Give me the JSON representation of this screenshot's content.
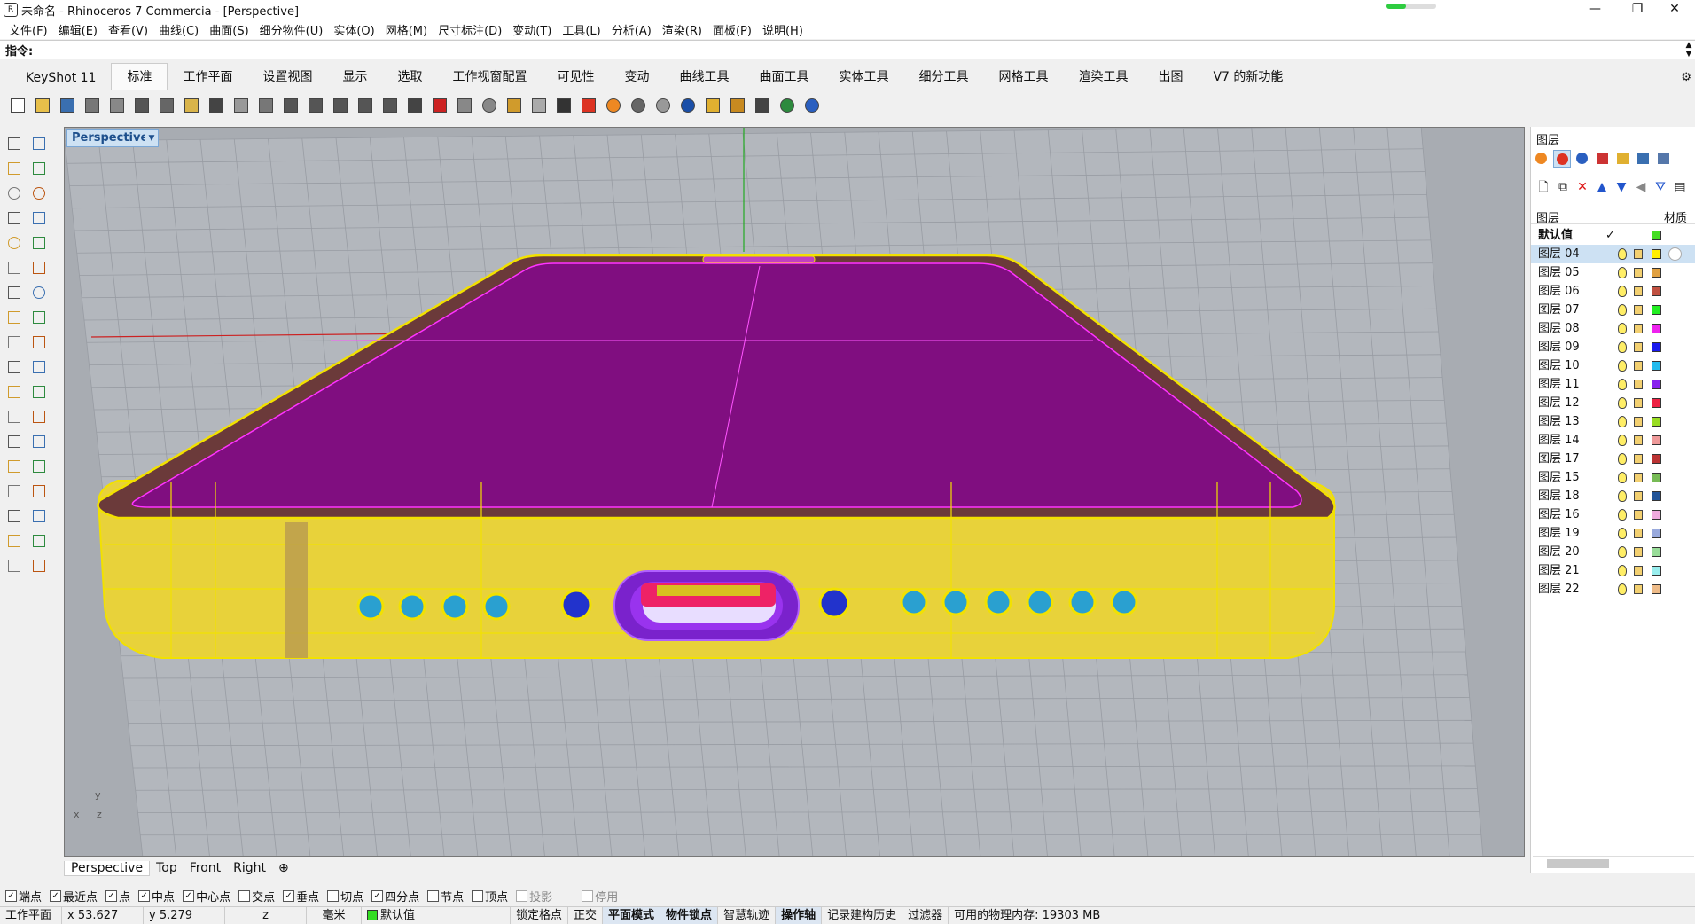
{
  "window": {
    "title": "未命名 - Rhinoceros 7 Commercia - [Perspective]",
    "app_icon": "rhino-icon",
    "progress_percent": 40,
    "controls": {
      "minimize": "—",
      "restore": "❐",
      "close": "✕"
    }
  },
  "menubar": {
    "items": [
      "文件(F)",
      "编辑(E)",
      "查看(V)",
      "曲线(C)",
      "曲面(S)",
      "细分物件(U)",
      "实体(O)",
      "网格(M)",
      "尺寸标注(D)",
      "变动(T)",
      "工具(L)",
      "分析(A)",
      "渲染(R)",
      "面板(P)",
      "说明(H)"
    ]
  },
  "command": {
    "label": "指令:",
    "value": "",
    "scroll_up": "▲",
    "scroll_down": "▼"
  },
  "tabs": {
    "items": [
      "KeyShot 11",
      "标准",
      "工作平面",
      "设置视图",
      "显示",
      "选取",
      "工作视窗配置",
      "可见性",
      "变动",
      "曲线工具",
      "曲面工具",
      "实体工具",
      "细分工具",
      "网格工具",
      "渲染工具",
      "出图",
      "V7 的新功能"
    ],
    "active_index": 1,
    "gear": "⚙"
  },
  "toolbar": {
    "icons": [
      {
        "name": "new-file-icon",
        "color": "#ffffff"
      },
      {
        "name": "open-folder-icon",
        "color": "#e8c04a"
      },
      {
        "name": "save-icon",
        "color": "#3a6fb0"
      },
      {
        "name": "print-icon",
        "color": "#777777"
      },
      {
        "name": "export-icon",
        "color": "#888888"
      },
      {
        "name": "cut-icon",
        "color": "#555555"
      },
      {
        "name": "copy-icon",
        "color": "#666666"
      },
      {
        "name": "paste-icon",
        "color": "#d9b44a"
      },
      {
        "name": "undo-icon",
        "color": "#444444"
      },
      {
        "name": "pan-hand-icon",
        "color": "#999999"
      },
      {
        "name": "move-arrows-icon",
        "color": "#777777"
      },
      {
        "name": "zoom-window-icon",
        "color": "#555555"
      },
      {
        "name": "zoom-extents-icon",
        "color": "#555555"
      },
      {
        "name": "zoom-all-icon",
        "color": "#555555"
      },
      {
        "name": "zoom-selected-icon",
        "color": "#555555"
      },
      {
        "name": "rotate-view-icon",
        "color": "#555555"
      },
      {
        "name": "four-view-icon",
        "color": "#444444"
      },
      {
        "name": "car-icon",
        "color": "#cc2222"
      },
      {
        "name": "plane-icon",
        "color": "#888888"
      },
      {
        "name": "snap-circle-icon",
        "color": "#888888"
      },
      {
        "name": "scale-icon",
        "color": "#d09b2c"
      },
      {
        "name": "bulb-icon",
        "color": "#aaaaaa"
      },
      {
        "name": "lock-icon",
        "color": "#333333"
      },
      {
        "name": "layer-icon",
        "color": "#dd3322"
      },
      {
        "name": "color-wheel-icon",
        "color": "#ee8822"
      },
      {
        "name": "shaded-sphere-icon",
        "color": "#666666"
      },
      {
        "name": "render-sphere-icon",
        "color": "#999999"
      },
      {
        "name": "blue-sphere-icon",
        "color": "#1a4fa8"
      },
      {
        "name": "pen-icon",
        "color": "#e0b030"
      },
      {
        "name": "gears-icon",
        "color": "#c88a20"
      },
      {
        "name": "grid-snap-icon",
        "color": "#444444"
      },
      {
        "name": "globe-icon",
        "color": "#2d8a3e"
      },
      {
        "name": "help-icon",
        "color": "#2a5fc0"
      }
    ]
  },
  "left_palette": {
    "icons": [
      "select-arrow-icon",
      "point-icon",
      "polyline-icon",
      "curve-icon",
      "circle-icon",
      "arc-icon",
      "polygon-icon",
      "rectangle-icon",
      "ellipse-icon",
      "freeform-icon",
      "surface-icon",
      "revolve-icon",
      "box-icon",
      "sphere-icon",
      "cylinder-icon",
      "mesh-icon",
      "boolean-icon",
      "fillet-icon",
      "trim-icon",
      "split-icon",
      "explode-icon",
      "join-icon",
      "move-icon",
      "rotate-icon",
      "text-icon",
      "dimension-icon",
      "array-icon",
      "mirror-icon",
      "solid-tools-icon",
      "plane-tools-icon",
      "grid-icon",
      "analyze-icon",
      "render-icon",
      "check-icon",
      "material-icon",
      "paint-icon"
    ]
  },
  "viewport": {
    "label": "Perspective",
    "dropdown": "▼",
    "axis_y": "y",
    "axis_x": "x",
    "axis_z": "z"
  },
  "viewport_tabs": {
    "items": [
      "Perspective",
      "Top",
      "Front",
      "Right"
    ],
    "add": "⊕",
    "active_index": 0
  },
  "osnaps": [
    {
      "label": "端点",
      "checked": true
    },
    {
      "label": "最近点",
      "checked": true
    },
    {
      "label": "点",
      "checked": true
    },
    {
      "label": "中点",
      "checked": true
    },
    {
      "label": "中心点",
      "checked": true
    },
    {
      "label": "交点",
      "checked": false
    },
    {
      "label": "垂点",
      "checked": true
    },
    {
      "label": "切点",
      "checked": false
    },
    {
      "label": "四分点",
      "checked": true
    },
    {
      "label": "节点",
      "checked": false
    },
    {
      "label": "顶点",
      "checked": false
    },
    {
      "label": "投影",
      "checked": false,
      "disabled": true
    },
    {
      "label": "停用",
      "checked": false,
      "disabled": true
    }
  ],
  "statusbar": {
    "cplane": "工作平面",
    "x": "x 53.627",
    "y": "y 5.279",
    "z": "z",
    "unit": "毫米",
    "layer": "默认值",
    "grid_snap": "锁定格点",
    "ortho": "正交",
    "planar": "平面模式",
    "osnap": "物件锁点",
    "smarttrack": "智慧轨迹",
    "gumball": "操作轴",
    "history": "记录建构历史",
    "filter": "过滤器",
    "memory": "可用的物理内存: 19303 MB"
  },
  "layers_panel": {
    "title": "图层",
    "tab_icons": [
      "color-wheel-icon",
      "layer-icon",
      "render-sphere-icon",
      "pen-icon",
      "folder-icon",
      "display-icon",
      "pdf-icon"
    ],
    "tools": [
      "new-layer-icon",
      "new-sublayer-icon",
      "delete-icon",
      "move-up-icon",
      "move-down-icon",
      "move-left-icon",
      "filter-icon",
      "options-icon"
    ],
    "tool_glyphs": [
      "🗋",
      "⧉",
      "✕",
      "▲",
      "▼",
      "◀",
      "⛛",
      "▤"
    ],
    "col_layer": "图层",
    "col_material": "材质",
    "default_row": {
      "name": "默认值",
      "check": "✓",
      "color": "#44dd22"
    },
    "selected_index": 0,
    "layers": [
      {
        "name": "图层 04",
        "color": "#ffee00",
        "material": true
      },
      {
        "name": "图层 05",
        "color": "#e0a040",
        "material": false
      },
      {
        "name": "图层 06",
        "color": "#c05040",
        "material": false
      },
      {
        "name": "图层 07",
        "color": "#22ee22",
        "material": false
      },
      {
        "name": "图层 08",
        "color": "#ee22ee",
        "material": false
      },
      {
        "name": "图层 09",
        "color": "#1a1aee",
        "material": false
      },
      {
        "name": "图层 10",
        "color": "#22bbee",
        "material": false
      },
      {
        "name": "图层 11",
        "color": "#8822ee",
        "material": false
      },
      {
        "name": "图层 12",
        "color": "#ee2244",
        "material": false
      },
      {
        "name": "图层 13",
        "color": "#99dd22",
        "material": false
      },
      {
        "name": "图层 14",
        "color": "#ee9999",
        "material": false
      },
      {
        "name": "图层 17",
        "color": "#bb3333",
        "material": false
      },
      {
        "name": "图层 15",
        "color": "#77bb55",
        "material": false
      },
      {
        "name": "图层 18",
        "color": "#225599",
        "material": false
      },
      {
        "name": "图层 16",
        "color": "#eeaadd",
        "material": false
      },
      {
        "name": "图层 19",
        "color": "#99aadd",
        "material": false
      },
      {
        "name": "图层 20",
        "color": "#99dd99",
        "material": false
      },
      {
        "name": "图层 21",
        "color": "#99eeee",
        "material": false
      },
      {
        "name": "图层 22",
        "color": "#eebb88",
        "material": false
      }
    ]
  }
}
